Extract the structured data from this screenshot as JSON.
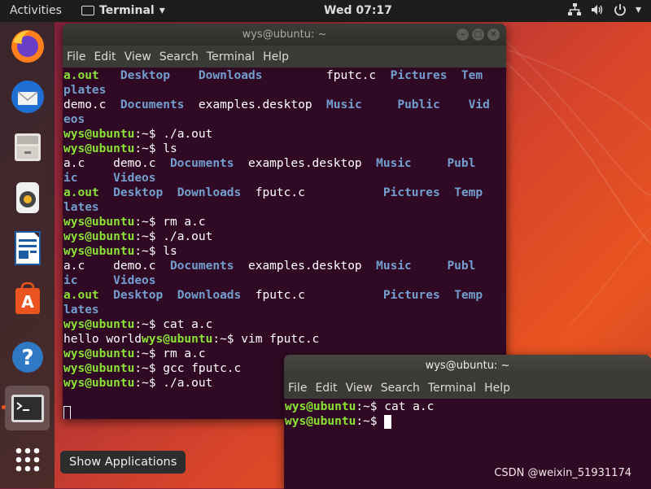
{
  "topbar": {
    "activities": "Activities",
    "app_name": "Terminal",
    "app_arrow": "▾",
    "clock": "Wed 07:17",
    "status_icons": [
      "network-icon",
      "volume-icon",
      "power-icon"
    ],
    "status_arrow": "▾"
  },
  "dock": {
    "items": [
      {
        "name": "firefox-icon"
      },
      {
        "name": "thunderbird-icon"
      },
      {
        "name": "files-icon"
      },
      {
        "name": "rhythmbox-icon"
      },
      {
        "name": "libreoffice-writer-icon"
      },
      {
        "name": "software-center-icon"
      },
      {
        "name": "help-icon"
      },
      {
        "name": "terminal-icon",
        "active": true
      },
      {
        "name": "show-applications-icon"
      }
    ],
    "tooltip": "Show Applications"
  },
  "windows": {
    "main": {
      "title": "wys@ubuntu: ~",
      "menu": [
        "File",
        "Edit",
        "View",
        "Search",
        "Terminal",
        "Help"
      ],
      "lines": [
        [
          {
            "t": "a.out",
            "c": "exe"
          },
          {
            "t": "   "
          },
          {
            "t": "Desktop",
            "c": "dir"
          },
          {
            "t": "    "
          },
          {
            "t": "Downloads",
            "c": "dir"
          },
          {
            "t": "         fputc.c  "
          },
          {
            "t": "Pictures",
            "c": "dir"
          },
          {
            "t": "  "
          },
          {
            "t": "Tem",
            "c": "dir"
          }
        ],
        [
          {
            "t": "plates",
            "c": "dir"
          }
        ],
        [
          {
            "t": "demo.c  "
          },
          {
            "t": "Documents",
            "c": "dir"
          },
          {
            "t": "  examples.desktop  "
          },
          {
            "t": "Music",
            "c": "dir"
          },
          {
            "t": "     "
          },
          {
            "t": "Public",
            "c": "dir"
          },
          {
            "t": "    "
          },
          {
            "t": "Vid",
            "c": "dir"
          }
        ],
        [
          {
            "t": "eos",
            "c": "dir"
          }
        ],
        [
          {
            "t": "wys@ubuntu",
            "c": "prompt"
          },
          {
            "t": ":~$ ./a.out"
          }
        ],
        [
          {
            "t": "wys@ubuntu",
            "c": "prompt"
          },
          {
            "t": ":~$ ls"
          }
        ],
        [
          {
            "t": "a.c    demo.c  "
          },
          {
            "t": "Documents",
            "c": "dir"
          },
          {
            "t": "  examples.desktop  "
          },
          {
            "t": "Music",
            "c": "dir"
          },
          {
            "t": "     "
          },
          {
            "t": "Publ",
            "c": "dir"
          }
        ],
        [
          {
            "t": "ic",
            "c": "dir"
          },
          {
            "t": "     "
          },
          {
            "t": "Videos",
            "c": "dir"
          }
        ],
        [
          {
            "t": "a.out",
            "c": "exe"
          },
          {
            "t": "  "
          },
          {
            "t": "Desktop",
            "c": "dir"
          },
          {
            "t": "  "
          },
          {
            "t": "Downloads",
            "c": "dir"
          },
          {
            "t": "  fputc.c           "
          },
          {
            "t": "Pictures",
            "c": "dir"
          },
          {
            "t": "  "
          },
          {
            "t": "Temp",
            "c": "dir"
          }
        ],
        [
          {
            "t": "lates",
            "c": "dir"
          }
        ],
        [
          {
            "t": "wys@ubuntu",
            "c": "prompt"
          },
          {
            "t": ":~$ rm a.c"
          }
        ],
        [
          {
            "t": "wys@ubuntu",
            "c": "prompt"
          },
          {
            "t": ":~$ ./a.out"
          }
        ],
        [
          {
            "t": "wys@ubuntu",
            "c": "prompt"
          },
          {
            "t": ":~$ ls"
          }
        ],
        [
          {
            "t": "a.c    demo.c  "
          },
          {
            "t": "Documents",
            "c": "dir"
          },
          {
            "t": "  examples.desktop  "
          },
          {
            "t": "Music",
            "c": "dir"
          },
          {
            "t": "     "
          },
          {
            "t": "Publ",
            "c": "dir"
          }
        ],
        [
          {
            "t": "ic",
            "c": "dir"
          },
          {
            "t": "     "
          },
          {
            "t": "Videos",
            "c": "dir"
          }
        ],
        [
          {
            "t": "a.out",
            "c": "exe"
          },
          {
            "t": "  "
          },
          {
            "t": "Desktop",
            "c": "dir"
          },
          {
            "t": "  "
          },
          {
            "t": "Downloads",
            "c": "dir"
          },
          {
            "t": "  fputc.c           "
          },
          {
            "t": "Pictures",
            "c": "dir"
          },
          {
            "t": "  "
          },
          {
            "t": "Temp",
            "c": "dir"
          }
        ],
        [
          {
            "t": "lates",
            "c": "dir"
          }
        ],
        [
          {
            "t": "wys@ubuntu",
            "c": "prompt"
          },
          {
            "t": ":~$ cat a.c"
          }
        ],
        [
          {
            "t": "hello world"
          },
          {
            "t": "wys@ubuntu",
            "c": "prompt"
          },
          {
            "t": ":~$ vim fputc.c"
          }
        ],
        [
          {
            "t": "wys@ubuntu",
            "c": "prompt"
          },
          {
            "t": ":~$ rm a.c"
          }
        ],
        [
          {
            "t": "wys@ubuntu",
            "c": "prompt"
          },
          {
            "t": ":~$ gcc fputc.c"
          }
        ],
        [
          {
            "t": "wys@ubuntu",
            "c": "prompt"
          },
          {
            "t": ":~$ ./a.out"
          }
        ],
        [],
        [
          {
            "cursor": "outline"
          }
        ]
      ]
    },
    "second": {
      "title": "wys@ubuntu: ~",
      "menu": [
        "File",
        "Edit",
        "View",
        "Search",
        "Terminal",
        "Help"
      ],
      "lines": [
        [
          {
            "t": "wys@ubuntu",
            "c": "prompt"
          },
          {
            "t": ":~$ cat a.c"
          }
        ],
        [
          {
            "t": "wys@ubuntu",
            "c": "prompt"
          },
          {
            "t": ":~$ "
          },
          {
            "cursor": "block"
          }
        ]
      ]
    }
  },
  "watermark": "CSDN @weixin_51931174",
  "colors": {
    "terminal_bg": "#300a24",
    "prompt": "#8ae234",
    "directory": "#729fcf",
    "accent": "#e95420"
  }
}
